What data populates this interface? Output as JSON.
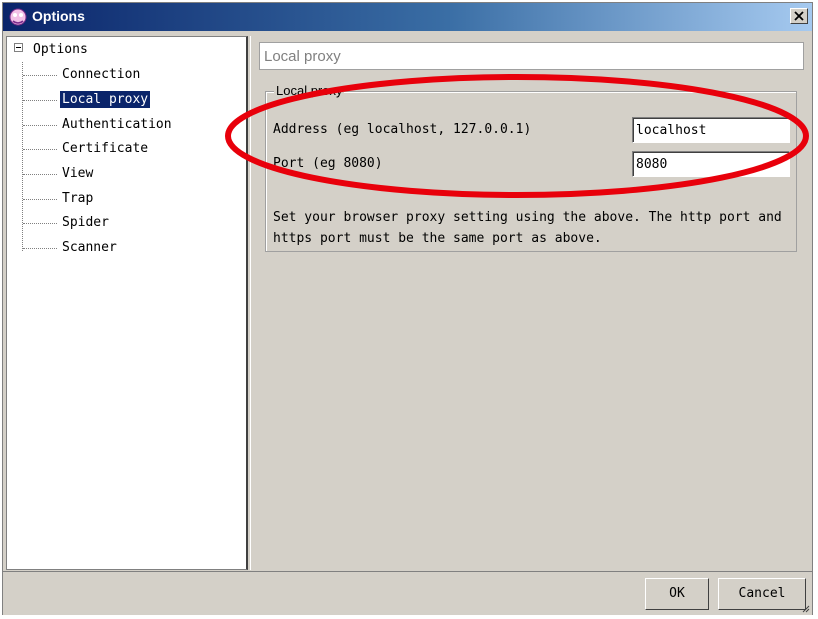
{
  "window": {
    "title": "Options"
  },
  "tree": {
    "root": "Options",
    "items": [
      {
        "label": "Connection",
        "selected": false
      },
      {
        "label": "Local proxy",
        "selected": true
      },
      {
        "label": "Authentication",
        "selected": false
      },
      {
        "label": "Certificate",
        "selected": false
      },
      {
        "label": "View",
        "selected": false
      },
      {
        "label": "Trap",
        "selected": false
      },
      {
        "label": "Spider",
        "selected": false
      },
      {
        "label": "Scanner",
        "selected": false
      }
    ]
  },
  "panel": {
    "header": "Local proxy",
    "group_title": "Local proxy",
    "address_label": "Address (eg localhost, 127.0.0.1)",
    "address_value": "localhost",
    "port_label": "Port (eg 8080)",
    "port_value": "8080",
    "help_text": "Set your browser proxy setting using the above. The http port and https port must be the same port as above."
  },
  "buttons": {
    "ok": "OK",
    "cancel": "Cancel"
  },
  "colors": {
    "highlight": "#e8000b",
    "selection": "#0a246a",
    "titlebar": "#0a246a"
  }
}
